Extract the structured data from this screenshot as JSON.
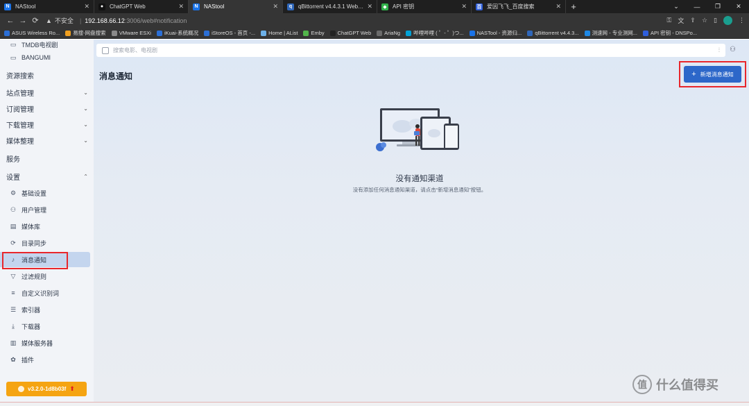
{
  "browser": {
    "tabs": [
      {
        "title": "NAStool",
        "icon": "N",
        "color": "#1a73e8",
        "active": false
      },
      {
        "title": "ChatGPT Web",
        "icon": "●",
        "color": "#111",
        "active": false
      },
      {
        "title": "NAStool",
        "icon": "N",
        "color": "#1a73e8",
        "active": true
      },
      {
        "title": "qBittorrent v4.4.3.1 Web UI",
        "icon": "q",
        "color": "#2f67ba",
        "active": false
      },
      {
        "title": "API 密钥",
        "icon": "◆",
        "color": "#31b04a",
        "active": false
      },
      {
        "title": "爱因飞飞_百度搜索",
        "icon": "百",
        "color": "#2f5fdc",
        "active": false
      }
    ],
    "new_tab": "+",
    "url_warning": "不安全",
    "url_host": "192.168.66.12",
    "url_path": ":3006/web#notification",
    "bookmarks": [
      {
        "label": "ASUS Wireless Ro...",
        "color": "#2b6fd6"
      },
      {
        "label": "易搜-网盘搜索",
        "color": "#f0a020"
      },
      {
        "label": "VMware ESXi",
        "color": "#8a8a8a"
      },
      {
        "label": "iKuai-系统概况",
        "color": "#2b6fd6"
      },
      {
        "label": "iStoreOS - 首页 -...",
        "color": "#2b6fd6"
      },
      {
        "label": "Home | AList",
        "color": "#6cb0e8"
      },
      {
        "label": "Emby",
        "color": "#52b54b"
      },
      {
        "label": "ChatGPT Web",
        "color": "#222"
      },
      {
        "label": "AriaNg",
        "color": "#6b6b6b"
      },
      {
        "label": "哔哩哔哩 ( ゜- ゜)つ...",
        "color": "#00a1d6"
      },
      {
        "label": "NASTool - 资源归...",
        "color": "#1a73e8"
      },
      {
        "label": "qBittorrent v4.4.3...",
        "color": "#2f67ba"
      },
      {
        "label": "测速网 - 专业测网...",
        "color": "#1e88e5"
      },
      {
        "label": "API 密钥 - DNSPo...",
        "color": "#2f5fdc"
      }
    ]
  },
  "sidebar": {
    "items": [
      {
        "label": "TMDB电视剧",
        "icon": "tv-icon",
        "glyph": "▭",
        "type": "sub"
      },
      {
        "label": "BANGUMI",
        "icon": "tv-icon",
        "glyph": "▭",
        "type": "sub"
      },
      {
        "label": "资源搜索",
        "type": "top"
      },
      {
        "label": "站点管理",
        "type": "top",
        "chevron": "⌄"
      },
      {
        "label": "订阅管理",
        "type": "top",
        "chevron": "⌄"
      },
      {
        "label": "下载管理",
        "type": "top",
        "chevron": "⌄"
      },
      {
        "label": "媒体整理",
        "type": "top",
        "chevron": "⌄"
      },
      {
        "label": "服务",
        "type": "top"
      },
      {
        "label": "设置",
        "type": "top",
        "chevron": "⌃"
      },
      {
        "label": "基础设置",
        "icon": "settings-icon",
        "glyph": "⚙",
        "type": "sub"
      },
      {
        "label": "用户管理",
        "icon": "users-icon",
        "glyph": "⚇",
        "type": "sub"
      },
      {
        "label": "媒体库",
        "icon": "library-icon",
        "glyph": "▤",
        "type": "sub"
      },
      {
        "label": "目录同步",
        "icon": "sync-icon",
        "glyph": "⟳",
        "type": "sub"
      },
      {
        "label": "消息通知",
        "icon": "bell-icon",
        "glyph": "♪",
        "type": "sub",
        "active": true
      },
      {
        "label": "过滤规则",
        "icon": "filter-icon",
        "glyph": "▽",
        "type": "sub"
      },
      {
        "label": "自定义识别词",
        "icon": "text-icon",
        "glyph": "≡",
        "type": "sub"
      },
      {
        "label": "索引器",
        "icon": "indexer-icon",
        "glyph": "☰",
        "type": "sub"
      },
      {
        "label": "下载器",
        "icon": "download-icon",
        "glyph": "⤓",
        "type": "sub"
      },
      {
        "label": "媒体服务器",
        "icon": "server-icon",
        "glyph": "▥",
        "type": "sub"
      },
      {
        "label": "插件",
        "icon": "plugin-icon",
        "glyph": "✿",
        "type": "sub"
      }
    ],
    "version": "v3.2.0-1d8b03f"
  },
  "search": {
    "placeholder": "搜索电影、电视剧"
  },
  "page": {
    "title": "消息通知",
    "add_button": "新增消息通知",
    "empty_title": "没有通知渠道",
    "empty_desc": "没有添加任何消息通知渠道，请点击“新增消息通知”按钮。"
  },
  "watermark": "什么值得买",
  "colors": {
    "primary": "#2c67c9",
    "highlight": "#e8262b",
    "version_bg": "#f5a412"
  }
}
